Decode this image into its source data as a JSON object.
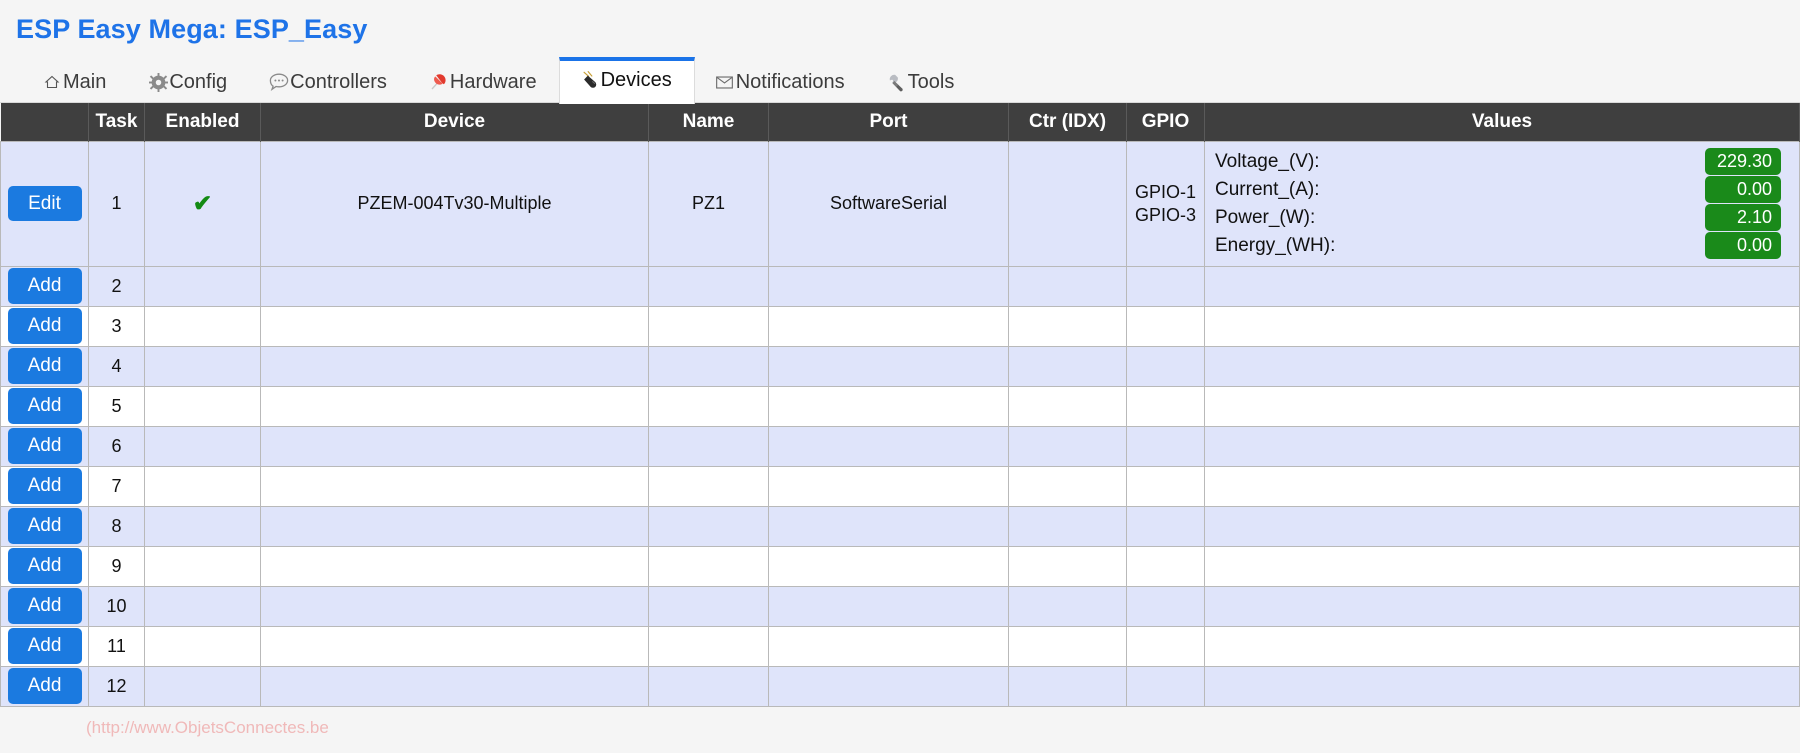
{
  "header": {
    "title": "ESP Easy Mega: ESP_Easy",
    "title_color": "#1e73e8"
  },
  "tabs": [
    {
      "label": "Main",
      "icon": "home-icon",
      "active": false
    },
    {
      "label": "Config",
      "icon": "gear-icon",
      "active": false
    },
    {
      "label": "Controllers",
      "icon": "speech-bubble-icon",
      "active": false
    },
    {
      "label": "Hardware",
      "icon": "pushpin-icon",
      "active": false
    },
    {
      "label": "Devices",
      "icon": "plug-icon",
      "active": true
    },
    {
      "label": "Notifications",
      "icon": "envelope-icon",
      "active": false
    },
    {
      "label": "Tools",
      "icon": "wrench-icon",
      "active": false
    }
  ],
  "table": {
    "columns": [
      "",
      "Task",
      "Enabled",
      "Device",
      "Name",
      "Port",
      "Ctr (IDX)",
      "GPIO",
      "Values"
    ],
    "rows": [
      {
        "action": "Edit",
        "task": "1",
        "enabled": "✔",
        "device": "PZEM-004Tv30-Multiple",
        "name": "PZ1",
        "port": "SoftwareSerial",
        "ctr_idx": "",
        "gpio": [
          "GPIO-1",
          "GPIO-3"
        ],
        "values": [
          {
            "label": "Voltage_(V):",
            "value": "229.30"
          },
          {
            "label": "Current_(A):",
            "value": "0.00"
          },
          {
            "label": "Power_(W):",
            "value": "2.10"
          },
          {
            "label": "Energy_(WH):",
            "value": "0.00"
          }
        ]
      },
      {
        "action": "Add",
        "task": "2",
        "enabled": "",
        "device": "",
        "name": "",
        "port": "",
        "ctr_idx": "",
        "gpio": [],
        "values": []
      },
      {
        "action": "Add",
        "task": "3",
        "enabled": "",
        "device": "",
        "name": "",
        "port": "",
        "ctr_idx": "",
        "gpio": [],
        "values": []
      },
      {
        "action": "Add",
        "task": "4",
        "enabled": "",
        "device": "",
        "name": "",
        "port": "",
        "ctr_idx": "",
        "gpio": [],
        "values": []
      },
      {
        "action": "Add",
        "task": "5",
        "enabled": "",
        "device": "",
        "name": "",
        "port": "",
        "ctr_idx": "",
        "gpio": [],
        "values": []
      },
      {
        "action": "Add",
        "task": "6",
        "enabled": "",
        "device": "",
        "name": "",
        "port": "",
        "ctr_idx": "",
        "gpio": [],
        "values": []
      },
      {
        "action": "Add",
        "task": "7",
        "enabled": "",
        "device": "",
        "name": "",
        "port": "",
        "ctr_idx": "",
        "gpio": [],
        "values": []
      },
      {
        "action": "Add",
        "task": "8",
        "enabled": "",
        "device": "",
        "name": "",
        "port": "",
        "ctr_idx": "",
        "gpio": [],
        "values": []
      },
      {
        "action": "Add",
        "task": "9",
        "enabled": "",
        "device": "",
        "name": "",
        "port": "",
        "ctr_idx": "",
        "gpio": [],
        "values": []
      },
      {
        "action": "Add",
        "task": "10",
        "enabled": "",
        "device": "",
        "name": "",
        "port": "",
        "ctr_idx": "",
        "gpio": [],
        "values": []
      },
      {
        "action": "Add",
        "task": "11",
        "enabled": "",
        "device": "",
        "name": "",
        "port": "",
        "ctr_idx": "",
        "gpio": [],
        "values": []
      },
      {
        "action": "Add",
        "task": "12",
        "enabled": "",
        "device": "",
        "name": "",
        "port": "",
        "ctr_idx": "",
        "gpio": [],
        "values": []
      }
    ]
  },
  "watermark": {
    "text": "(http://www.ObjetsConnectes.be",
    "color": "#f0b9b9"
  },
  "colors": {
    "accent_blue": "#1b7ae0",
    "header_dark": "#3f3f3f",
    "row_highlight": "#dfe4fa",
    "badge_green": "#1a8a1a",
    "check_green": "#138a13"
  }
}
